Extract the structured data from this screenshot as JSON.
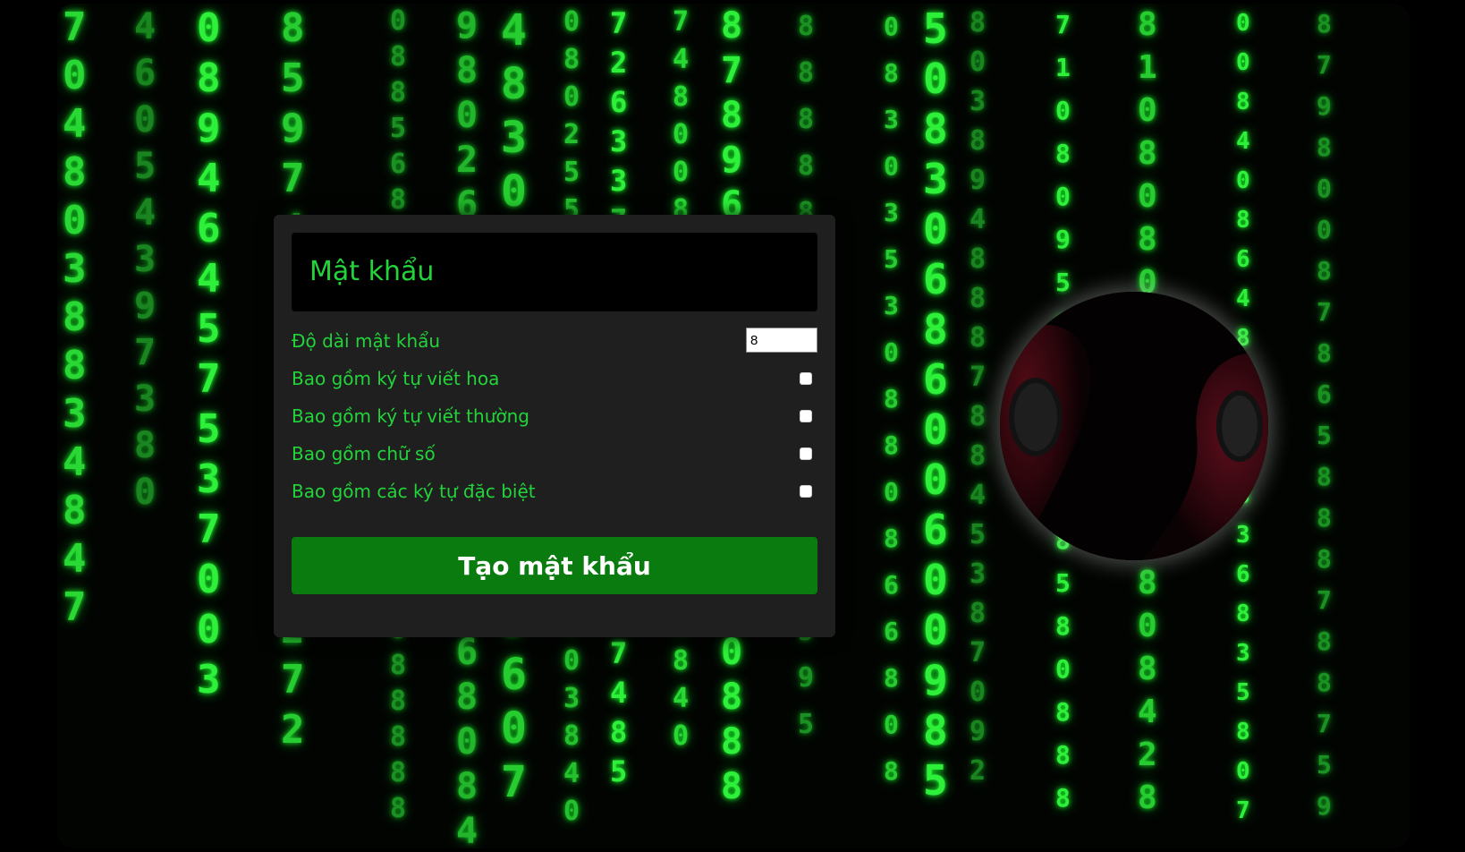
{
  "generator": {
    "password_placeholder": "Mật khẩu",
    "length_label": "Độ dài mật khẩu",
    "length_value": "8",
    "uppercase_label": "Bao gồm ký tự viết hoa",
    "uppercase_checked": false,
    "lowercase_label": "Bao gồm ký tự viết thường",
    "lowercase_checked": false,
    "numbers_label": "Bao gồm chữ số",
    "numbers_checked": false,
    "symbols_label": "Bao gồm các ký tự đặc biệt",
    "symbols_checked": false,
    "generate_label": "Tạo mật khẩu"
  },
  "colors": {
    "background": "#000000",
    "rain_green": "#2ef03a",
    "panel": "#1f1f1f",
    "label_green": "#22d43a",
    "button_green": "#0a7c0f"
  },
  "icons": {
    "avatar": "hooded-anonymous-figures-image"
  }
}
